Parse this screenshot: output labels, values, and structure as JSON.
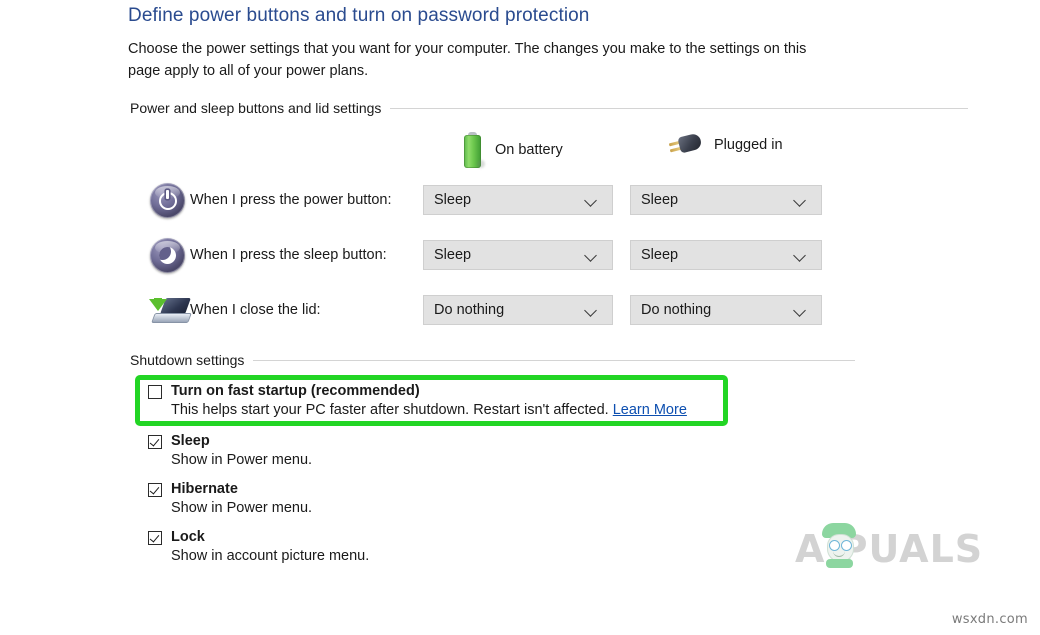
{
  "header": {
    "title": "Define power buttons and turn on password protection",
    "description": "Choose the power settings that you want for your computer. The changes you make to the settings on this page apply to all of your power plans."
  },
  "colors": {
    "title_blue": "#2a4b8f",
    "link_blue": "#0d4fb0",
    "highlight_green": "#22d524",
    "dropdown_bg": "#e2e2e2",
    "rule_gray": "#d4d4d4"
  },
  "power_section": {
    "group_label": "Power and sleep buttons and lid settings",
    "columns": [
      {
        "label": "On battery",
        "icon": "battery-icon"
      },
      {
        "label": "Plugged in",
        "icon": "power-plug-icon"
      }
    ],
    "rows": [
      {
        "icon": "power-button-icon",
        "label": "When I press the power button:",
        "on_battery": "Sleep",
        "plugged_in": "Sleep"
      },
      {
        "icon": "sleep-button-icon",
        "label": "When I press the sleep button:",
        "on_battery": "Sleep",
        "plugged_in": "Sleep"
      },
      {
        "icon": "laptop-lid-icon",
        "label": "When I close the lid:",
        "on_battery": "Do nothing",
        "plugged_in": "Do nothing"
      }
    ]
  },
  "shutdown_section": {
    "group_label": "Shutdown settings",
    "items": [
      {
        "title": "Turn on fast startup (recommended)",
        "description": "This helps start your PC faster after shutdown. Restart isn't affected.",
        "link_text": "Learn More",
        "checked": false,
        "highlighted": true
      },
      {
        "title": "Sleep",
        "description": "Show in Power menu.",
        "checked": true,
        "highlighted": false
      },
      {
        "title": "Hibernate",
        "description": "Show in Power menu.",
        "checked": true,
        "highlighted": false
      },
      {
        "title": "Lock",
        "description": "Show in account picture menu.",
        "checked": true,
        "highlighted": false
      }
    ]
  },
  "watermark": {
    "brand": "APPUALS",
    "brand_visible_text": "A    PUALS",
    "site_credit": "wsxdn.com"
  }
}
